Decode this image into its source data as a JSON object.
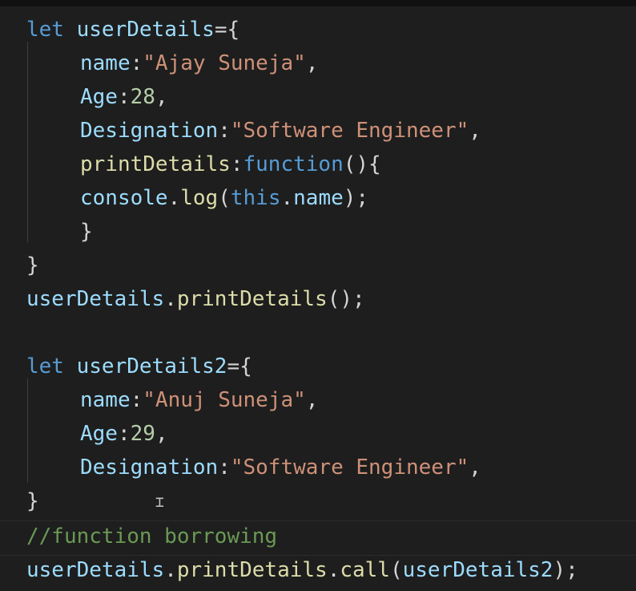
{
  "code": {
    "l1": {
      "kw": "let",
      "var": "userDetails",
      "op": "={"
    },
    "l2": {
      "key": "name",
      "colon": ":",
      "val": "\"Ajay Suneja\"",
      "end": ","
    },
    "l3": {
      "key": "Age",
      "colon": ":",
      "val": "28",
      "end": ","
    },
    "l4": {
      "key": "Designation",
      "colon": ":",
      "val": "\"Software Engineer\"",
      "end": ","
    },
    "l5": {
      "key": "printDetails",
      "colon": ":",
      "kw": "function",
      "end": "(){"
    },
    "l6": {
      "obj": "console",
      "dot": ".",
      "fn": "log",
      "open": "(",
      "kw": "this",
      "dot2": ".",
      "prop": "name",
      "close": ");"
    },
    "l7": {
      "text": "}"
    },
    "l8": {
      "text": "}"
    },
    "l9": {
      "obj": "userDetails",
      "dot": ".",
      "fn": "printDetails",
      "end": "();"
    },
    "l11": {
      "kw": "let",
      "var": "userDetails2",
      "op": "={"
    },
    "l12": {
      "key": "name",
      "colon": ":",
      "val": "\"Anuj Suneja\"",
      "end": ","
    },
    "l13": {
      "key": "Age",
      "colon": ":",
      "val": "29",
      "end": ","
    },
    "l14": {
      "key": "Designation",
      "colon": ":",
      "val": "\"Software Engineer\"",
      "end": ","
    },
    "l15": {
      "text": "}"
    },
    "l16": {
      "text": "//function borrowing"
    },
    "l17": {
      "obj": "userDetails",
      "dot": ".",
      "fn1": "printDetails",
      "dot2": ".",
      "fn2": "call",
      "open": "(",
      "arg": "userDetails2",
      "close": ");"
    }
  },
  "colors": {
    "background": "#1e1e1e",
    "keyword": "#569cd6",
    "variable": "#9cdcfe",
    "function": "#dcdcaa",
    "string": "#ce9178",
    "number": "#b5cea8",
    "comment": "#6a9955"
  },
  "cursor_icon": "text-cursor-icon"
}
